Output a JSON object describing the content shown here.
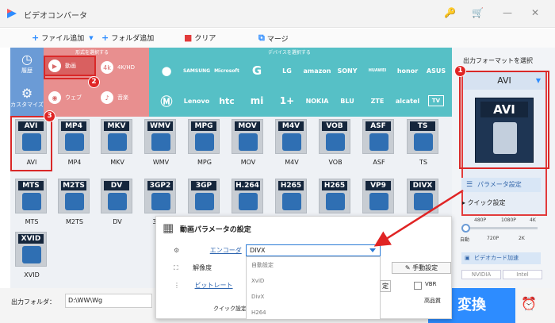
{
  "window": {
    "title": "ビデオコンバータ",
    "buttons": [
      "🔑",
      "🛒",
      "—",
      "✕"
    ]
  },
  "toolbar": {
    "add_file": "ファイル追加",
    "add_folder": "フォルダ追加",
    "clear": "クリア",
    "merge": "マージ"
  },
  "left_bar": [
    {
      "label": "履歴",
      "icon": "history-icon"
    },
    {
      "label": "カスタマイズ",
      "icon": "gear-icon"
    }
  ],
  "category_header": "形式を選択する",
  "device_header": "デバイスを選択する",
  "categories": [
    "動画",
    "4K/HD",
    "ウェブ",
    "音楽"
  ],
  "devices": [
    "",
    "SAMSUNG",
    "Microsoft",
    "G",
    "LG",
    "amazon",
    "SONY",
    "HUAWEI",
    "honor",
    "ASUS",
    "",
    "Lenovo",
    "htc",
    "mi",
    "1+",
    "NOKIA",
    "BLU",
    "ZTE",
    "alcatel",
    "TV"
  ],
  "formats": [
    {
      "tag": "AVI",
      "label": "AVI"
    },
    {
      "tag": "MP4",
      "label": "MP4"
    },
    {
      "tag": "MKV",
      "label": "MKV"
    },
    {
      "tag": "WMV",
      "label": "WMV"
    },
    {
      "tag": "MPG",
      "label": "MPG"
    },
    {
      "tag": "MOV",
      "label": "MOV"
    },
    {
      "tag": "M4V",
      "label": "M4V"
    },
    {
      "tag": "VOB",
      "label": "VOB"
    },
    {
      "tag": "ASF",
      "label": "ASF"
    },
    {
      "tag": "TS",
      "label": "TS"
    },
    {
      "tag": "MTS",
      "label": "MTS"
    },
    {
      "tag": "M2TS",
      "label": "M2TS"
    },
    {
      "tag": "DV",
      "label": "DV"
    },
    {
      "tag": "3GP2",
      "label": "3GP2"
    },
    {
      "tag": "3GP",
      "label": "3GP"
    },
    {
      "tag": "H.264",
      "label": ""
    },
    {
      "tag": "H265",
      "label": ""
    },
    {
      "tag": "H265",
      "label": ""
    },
    {
      "tag": "VP9",
      "label": ""
    },
    {
      "tag": "DIVX",
      "label": ""
    },
    {
      "tag": "XVID",
      "label": "XVID"
    }
  ],
  "right": {
    "title": "出力フォーマットを選択",
    "selected": "AVI",
    "selected_tag": "AVI",
    "param_button": "パラメータ設定",
    "quick_title": "クイック設定",
    "quick_top": [
      "480P",
      "1080P",
      "4K"
    ],
    "quick_bottom": [
      "自動",
      "720P",
      "2K"
    ],
    "gpu_title": "ビデオカード加速",
    "gpu": [
      "NVIDIA",
      "Intel"
    ]
  },
  "dialog": {
    "title": "動画パラメータの設定",
    "encoder_label": "エンコーダ",
    "encoder_value": "DIVX",
    "options": [
      "自動設定",
      "XviD",
      "DivX",
      "H264"
    ],
    "resolution_label": "解像度",
    "bitrate_label": "ビットレート",
    "quick_label": "クイック設定",
    "manual": "手動設定",
    "settei_button": "定",
    "vbr": "VBR",
    "quality": "高品質"
  },
  "bottom": {
    "folder_label": "出力フォルダ：",
    "folder_path": "D:\\WW\\Wg",
    "convert": "変換"
  },
  "markers": [
    "1",
    "2",
    "3"
  ],
  "colors": {
    "accent": "#2d8cff",
    "highlight": "#d92828",
    "category": "#e88f8f",
    "device": "#56c0c6"
  }
}
